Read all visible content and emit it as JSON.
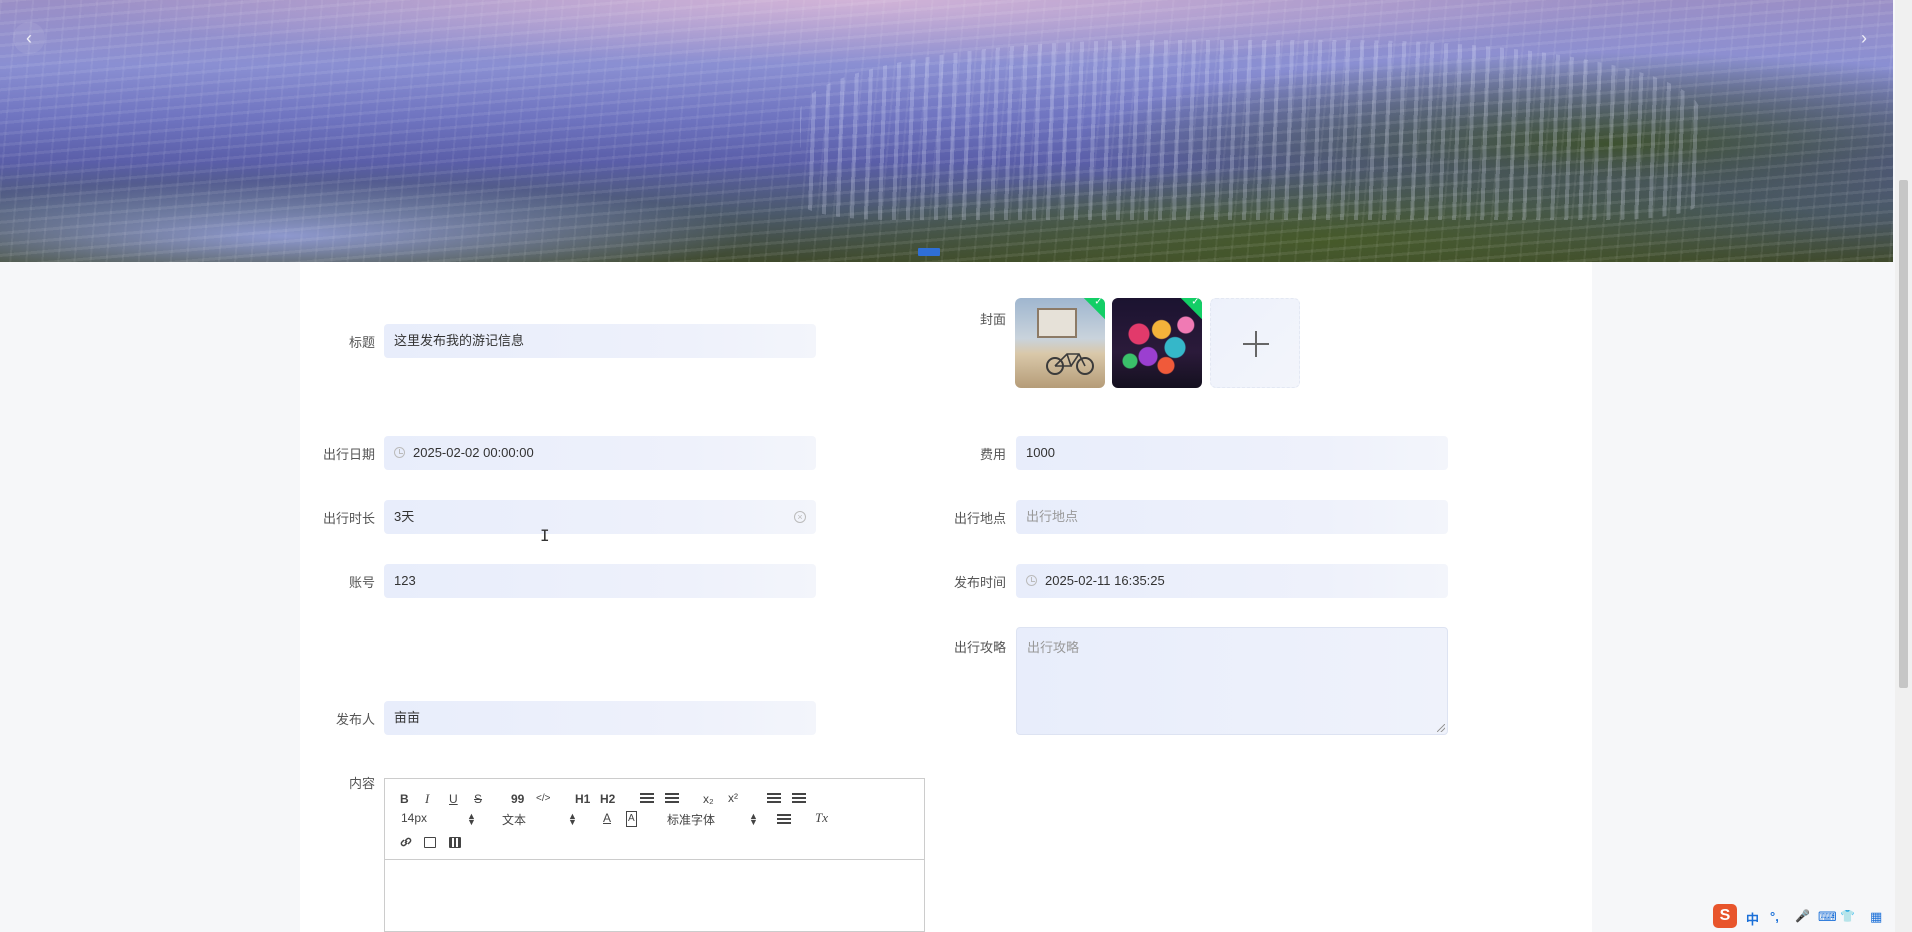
{
  "carousel": {
    "prev_icon": "‹",
    "next_icon": "›"
  },
  "form": {
    "title": {
      "label": "标题",
      "value": "这里发布我的游记信息"
    },
    "cover": {
      "label": "封面",
      "check_icon": "✓"
    },
    "travel_date": {
      "label": "出行日期",
      "value": "2025-02-02 00:00:00"
    },
    "cost": {
      "label": "费用",
      "value": "1000"
    },
    "duration": {
      "label": "出行时长",
      "value": "3天"
    },
    "location": {
      "label": "出行地点",
      "placeholder": "出行地点"
    },
    "account": {
      "label": "账号",
      "value": "123"
    },
    "publish_time": {
      "label": "发布时间",
      "value": "2025-02-11 16:35:25"
    },
    "guide": {
      "label": "出行攻略",
      "placeholder": "出行攻略"
    },
    "publisher": {
      "label": "发布人",
      "value": "亩亩"
    },
    "content": {
      "label": "内容"
    }
  },
  "editor": {
    "bold": "B",
    "italic": "I",
    "underline": "U",
    "strike": "S",
    "blockquote": "99",
    "code": "</>",
    "h1": "H1",
    "h2": "H2",
    "sub": "x₂",
    "sup": "x²",
    "font_size": "14px",
    "format": "文本",
    "font_family": "标准字体",
    "color_a": "A",
    "bg_a": "A",
    "clear": "Tx"
  },
  "tray": {
    "s": "S",
    "lang": "中",
    "punct": "°,",
    "mic": "🎤",
    "kbd": "⌨",
    "shirt": "👕",
    "grid": "▦"
  }
}
